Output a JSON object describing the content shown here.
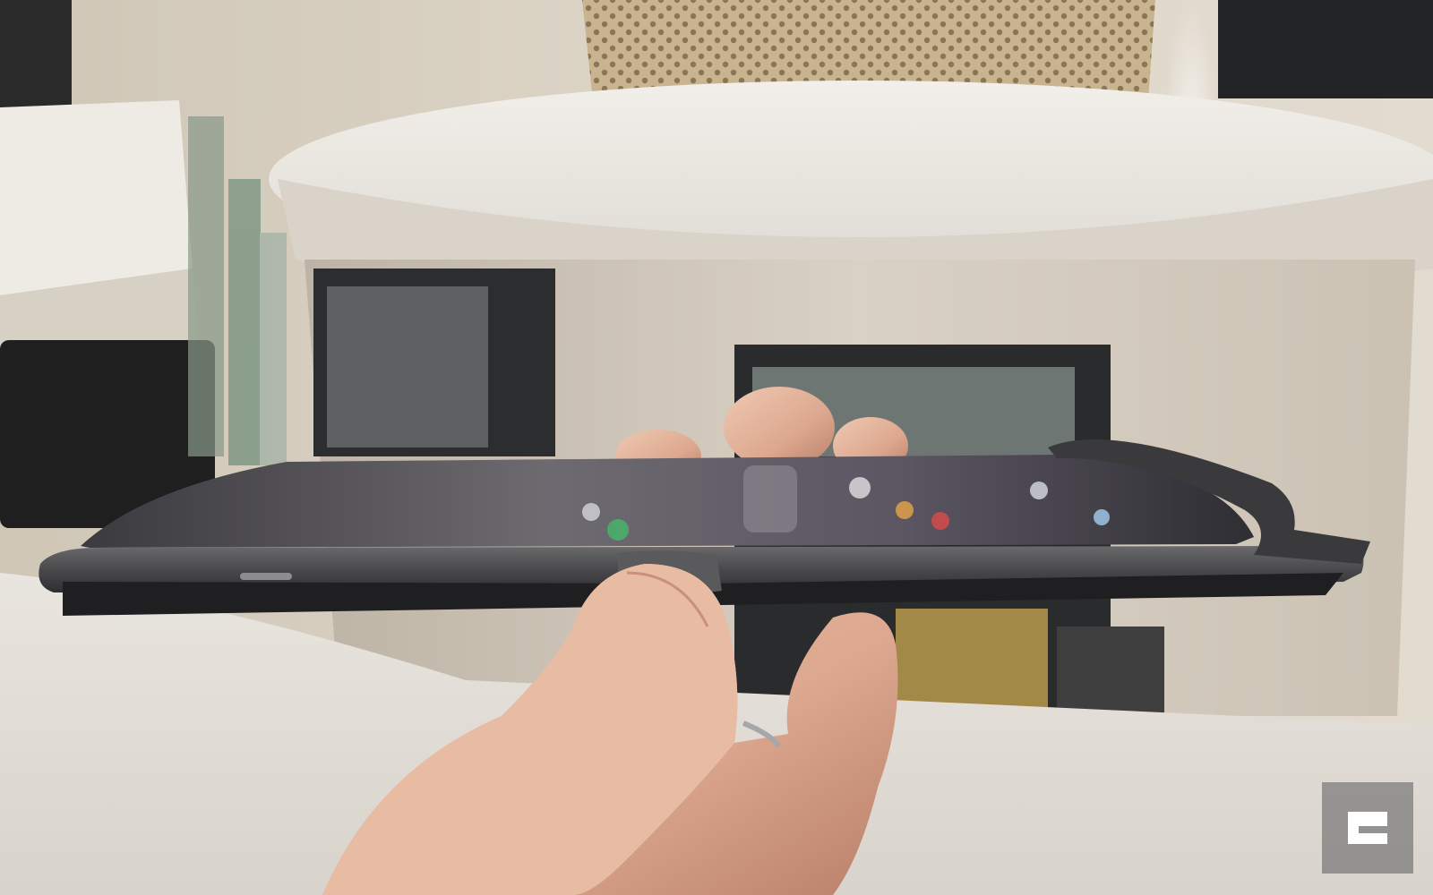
{
  "photo": {
    "subject": "foldable-phone-held-in-hand",
    "watermark_icon": "engadget-logo-icon",
    "colors": {
      "wall": "#d8d0c2",
      "table_top": "#ece8e1",
      "table_base": "#cfc7b9",
      "basket": "#c4b08a",
      "phone_body": "#4b4b4d",
      "phone_screen": "#3a3836",
      "skin": "#e3b7a0",
      "foreground_surface": "#e6e2dc",
      "watermark_bg": "#7a7a7a"
    }
  }
}
